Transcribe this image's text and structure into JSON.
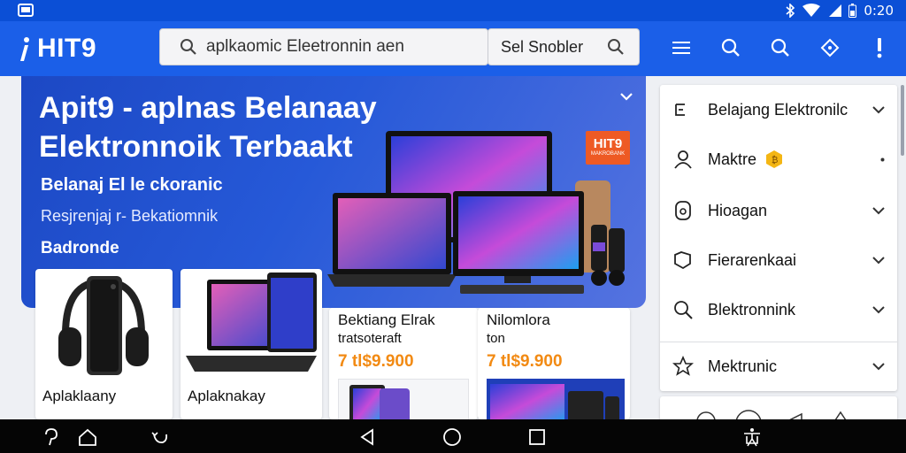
{
  "status": {
    "time": "0:20",
    "icons": [
      "gallery-icon",
      "bluetooth-icon",
      "wifi-icon",
      "signal-icon",
      "battery-icon"
    ]
  },
  "app": {
    "brand": "HIT9",
    "search_text": "aplkaomic Eleetronnin aen",
    "search_button": "Sel Snobler"
  },
  "hero": {
    "title": "Apit9 - aplnas Belanaay Elektronnoik Terbaakt",
    "line1": "Belanaj El le ckoranic",
    "line2": "Resjrenjaj r- Bekatiomnik",
    "line3": "Badronde",
    "badge": "HIT9",
    "badge_sub": "MAKROBANK"
  },
  "products": [
    {
      "name": "Aplaklaany",
      "price": ""
    },
    {
      "name": "Aplaknakay",
      "price": ""
    },
    {
      "name": "Bektiang Elrak",
      "sub": "tratsoteraft",
      "price": "7 tl$9.900"
    },
    {
      "name": "Nilomlora",
      "sub": "ton",
      "price": "7 tl$9.900"
    }
  ],
  "menu": [
    {
      "label": "Belajang Elektronilc",
      "icon": "list-icon",
      "chevron": true
    },
    {
      "label": "Maktre",
      "icon": "person-icon",
      "chevron": false,
      "badge": true
    },
    {
      "label": "Hioagan",
      "icon": "ring-icon",
      "chevron": true
    },
    {
      "label": "Fierarenkaai",
      "icon": "shield-icon",
      "chevron": true
    },
    {
      "label": "Blektronnink",
      "icon": "search-icon",
      "chevron": true
    },
    {
      "label": "Mektrunic",
      "icon": "star-icon",
      "chevron": true
    }
  ],
  "colors": {
    "status": "#0b4fd6",
    "appbar": "#1b5fe8",
    "price": "#f28a13",
    "badge": "#ee5a24"
  }
}
